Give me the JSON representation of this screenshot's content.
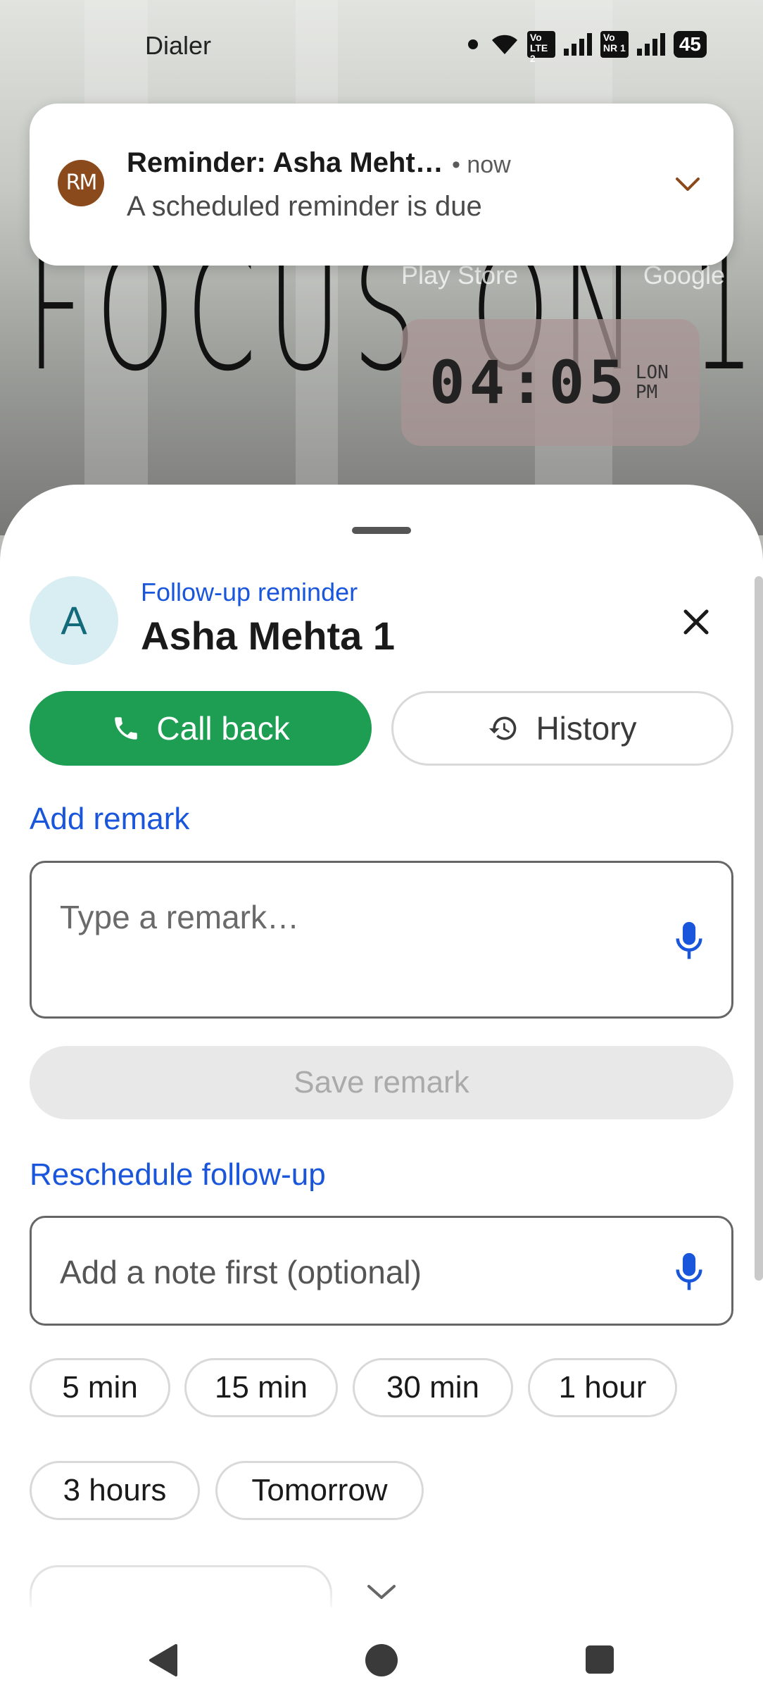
{
  "status_bar": {
    "app_name": "Dialer",
    "sim1_label": "Vo LTE 2",
    "sim2_label": "Vo NR 1",
    "battery": "45"
  },
  "wallpaper": {
    "title": "FOCUS ON 1",
    "shortcut_1": "Play Store",
    "shortcut_2": "Google",
    "clock_time": "04:05",
    "clock_zone": "LON",
    "clock_ampm": "PM"
  },
  "notification": {
    "avatar_initials": "RM",
    "title": "Reminder: Asha Meht…",
    "time": "• now",
    "text": "A scheduled reminder is due"
  },
  "sheet": {
    "avatar_letter": "A",
    "subtitle": "Follow-up reminder",
    "contact_name": "Asha Mehta 1",
    "call_back_label": "Call back",
    "history_label": "History",
    "add_remark_label": "Add remark",
    "remark_placeholder": "Type a remark…",
    "save_remark_label": "Save remark",
    "reschedule_label": "Reschedule follow-up",
    "note_placeholder": "Add a note first (optional)",
    "quick_times": [
      "5 min",
      "15 min",
      "30 min",
      "1 hour",
      "3 hours",
      "Tomorrow"
    ]
  },
  "colors": {
    "accent_blue": "#1a56db",
    "call_green": "#1e9e52",
    "notif_avatar": "#8a4a1c"
  }
}
